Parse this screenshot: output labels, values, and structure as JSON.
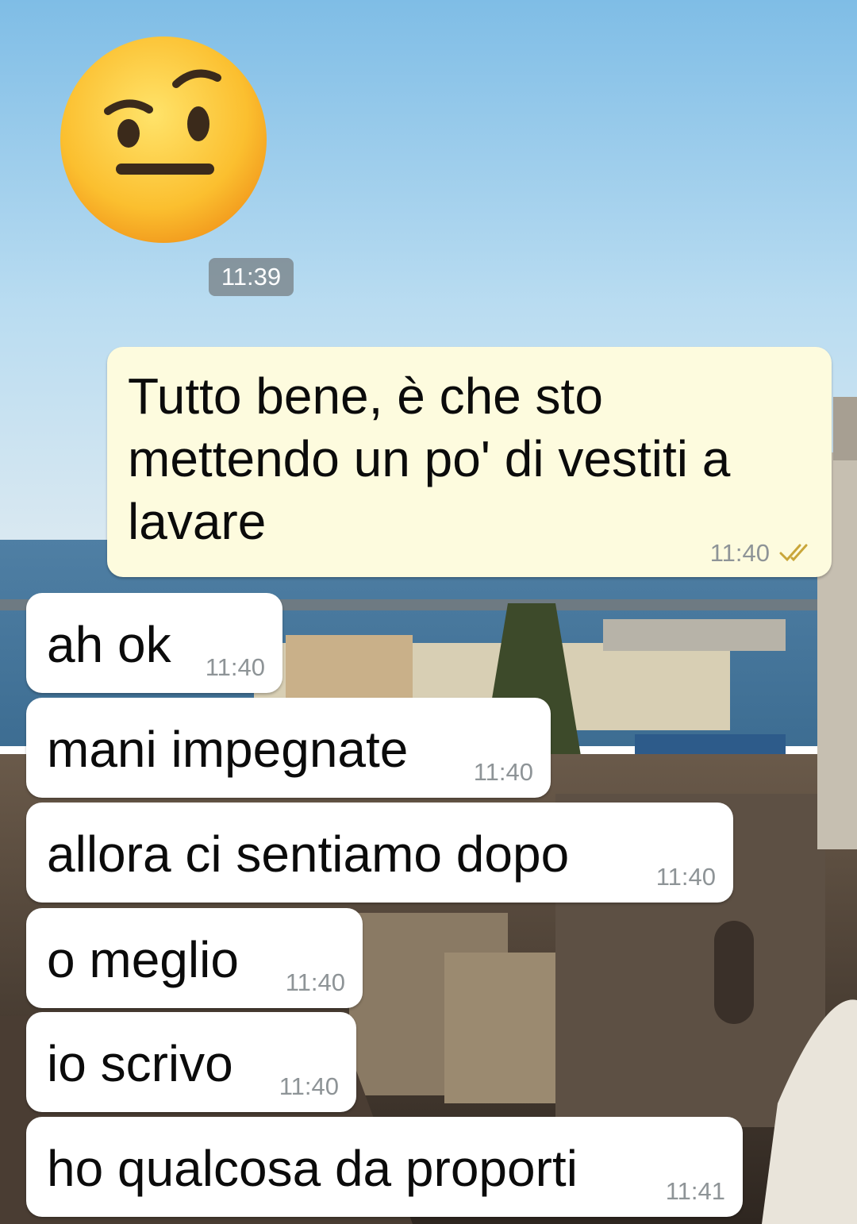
{
  "chat": {
    "emoji_sticker": {
      "icon": "face-with-raised-eyebrow-icon",
      "timestamp": "11:39"
    },
    "messages": [
      {
        "direction": "outgoing",
        "text": "Tutto bene, è che sto mettendo un po' di vestiti a lavare",
        "time": "11:40",
        "status_icon": "double-check-read-icon"
      },
      {
        "direction": "incoming",
        "text": "ah ok",
        "time": "11:40"
      },
      {
        "direction": "incoming",
        "text": "mani impegnate",
        "time": "11:40"
      },
      {
        "direction": "incoming",
        "text": "allora ci sentiamo dopo",
        "time": "11:40"
      },
      {
        "direction": "incoming",
        "text": "o meglio",
        "time": "11:40"
      },
      {
        "direction": "incoming",
        "text": "io scrivo",
        "time": "11:40"
      },
      {
        "direction": "incoming",
        "text": "ho qualcosa da proporti",
        "time": "11:41"
      }
    ]
  },
  "colors": {
    "outgoing_bubble": "#fdfbde",
    "incoming_bubble": "#ffffff",
    "timestamp_text": "#8e9497",
    "read_ticks": "#c9a63a"
  }
}
